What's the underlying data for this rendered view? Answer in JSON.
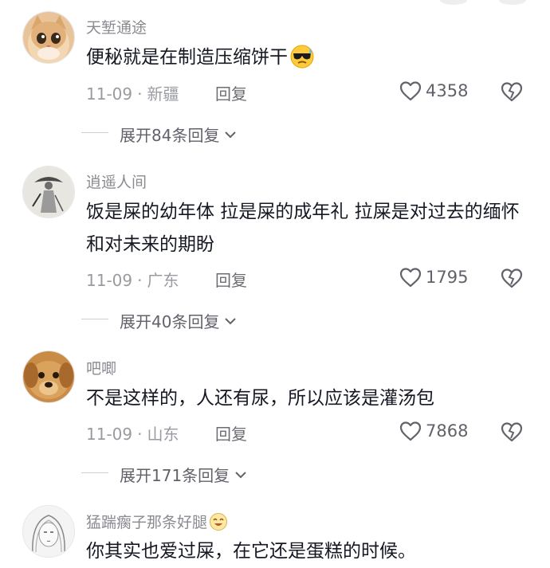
{
  "comments": [
    {
      "username": "天堑通途",
      "content": "便秘就是在制造压缩饼干",
      "emoji": "sunglasses-sweat-emoji",
      "date": "11-09",
      "location": "新疆",
      "reply_label": "回复",
      "likes": "4358",
      "expand_label": "展开84条回复",
      "avatar": "cat-photo"
    },
    {
      "username": "逍遥人间",
      "content": "饭是屎的幼年体 拉是屎的成年礼 拉屎是对过去的缅怀和对未来的期盼",
      "date": "11-09",
      "location": "广东",
      "reply_label": "回复",
      "likes": "1795",
      "expand_label": "展开40条回复",
      "avatar": "ink-wash-swordsman"
    },
    {
      "username": "吧唧",
      "content": "不是这样的，人还有尿，所以应该是灌汤包",
      "date": "11-09",
      "location": "山东",
      "reply_label": "回复",
      "likes": "7868",
      "expand_label": "展开171条回复",
      "avatar": "dog-photo"
    },
    {
      "username": "猛踹瘸子那条好腿",
      "username_emoji": "laughing-emoji",
      "content": "你其实也爱过屎，在它还是蛋糕的时候。",
      "avatar": "sketch-girl"
    }
  ],
  "colors": {
    "username": "#8a8b91",
    "content": "#161823",
    "meta": "#9a9ba1",
    "background": "#ffffff"
  },
  "icons": {
    "like": "heart-outline-icon",
    "dislike": "broken-heart-icon",
    "expand": "chevron-down-icon"
  }
}
